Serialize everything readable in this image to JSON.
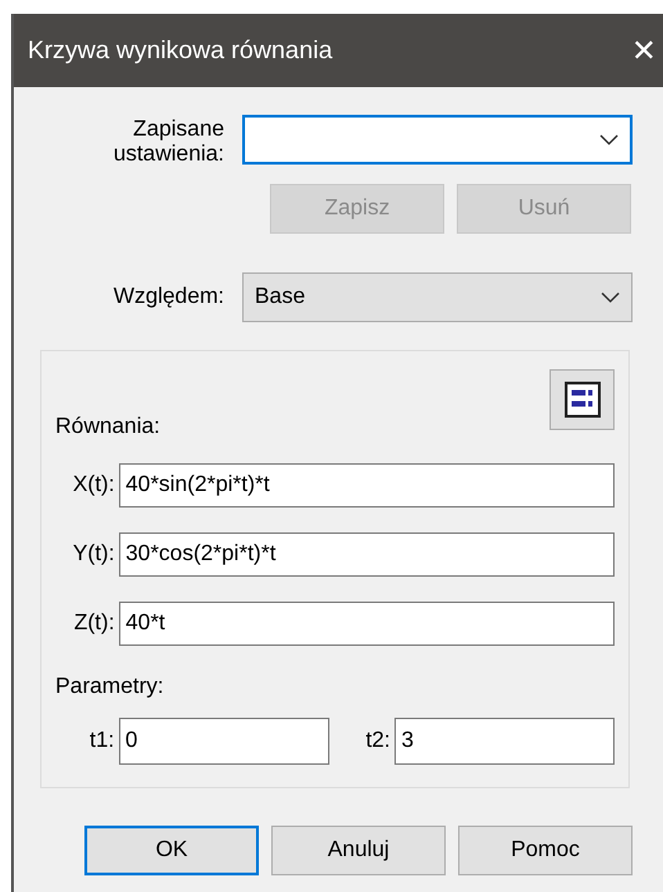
{
  "window": {
    "title": "Krzywa wynikowa równania",
    "close": "✕"
  },
  "saved_settings": {
    "label_lines": [
      "Zapisane",
      "ustawienia:"
    ],
    "focused": true,
    "buttons": [
      {
        "label": "Zapisz",
        "disabled": true
      },
      {
        "label": "Usuń",
        "disabled": true
      }
    ]
  },
  "relative_to": {
    "label": "Względem:",
    "value": "Base"
  },
  "equations": {
    "label": "Równania:",
    "rows": [
      {
        "label": "X(t):",
        "value": "40*sin(2*pi*t)*t"
      },
      {
        "label": "Y(t):",
        "value": "30*cos(2*pi*t)*t"
      },
      {
        "label": "Z(t):",
        "value": "40*t"
      }
    ]
  },
  "parameters": {
    "label": "Parametry:",
    "fields": [
      {
        "label": "t1:",
        "value": "0"
      },
      {
        "label": "t2:",
        "value": "3"
      }
    ]
  },
  "buttons": [
    {
      "label": "OK",
      "default": true
    },
    {
      "label": "Anuluj",
      "default": false
    },
    {
      "label": "Pomoc",
      "default": false
    }
  ]
}
